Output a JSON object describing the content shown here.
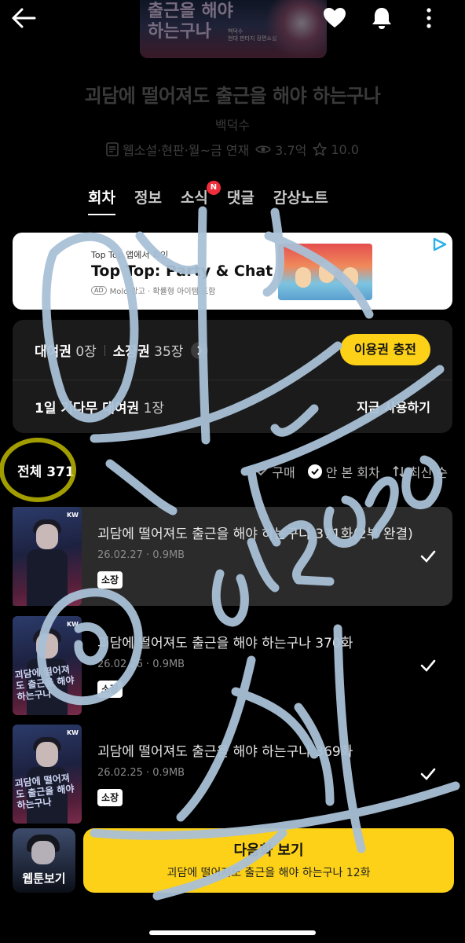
{
  "cover": {
    "title_art": "출근을 해야 하는구나",
    "author_line": "백덕수",
    "subtitle_line": "현대 판타지 장편소설"
  },
  "header": {
    "back_icon": "arrow-left-icon",
    "like_icon": "heart-icon",
    "notify_icon": "bell-icon",
    "more_icon": "more-vertical-icon"
  },
  "work": {
    "title": "괴담에 떨어져도 출근을 해야 하는구나",
    "author": "백덕수",
    "info": "웹소설·현판·월~금 연재",
    "views": "3.7억",
    "rating": "10.0"
  },
  "tabs": [
    {
      "label": "회차",
      "active": true
    },
    {
      "label": "정보",
      "active": false
    },
    {
      "label": "소식",
      "active": false,
      "badge": "N"
    },
    {
      "label": "댓글",
      "active": false
    },
    {
      "label": "감상노트",
      "active": false
    }
  ],
  "ad": {
    "line1": "Top Top 앱에서 확인",
    "title": "Top Top: Party & Chat",
    "badge": "AD",
    "line3": "Molo 광고 · 확률형 아이템 포함"
  },
  "passes": {
    "rental_label": "대여권",
    "rental_count": "0장",
    "own_label": "소장권",
    "own_count": "35장",
    "charge_label": "이용권 충전",
    "wait_label": "1일 기다무 대여권",
    "wait_count": "1장",
    "use_now": "지금 사용하기"
  },
  "list": {
    "total_label": "전체 371",
    "filter_buy": "구매",
    "filter_unread": "안 본 회차",
    "sort_label": "최신 순"
  },
  "episodes": [
    {
      "name": "괴담에 떨어져도 출근을 해야 하는구나 371화(2부 완결)",
      "date": "26.02.27 · 0.9MB",
      "tag": "소장",
      "thumb_title": "",
      "highlight": true
    },
    {
      "name": "괴담에 떨어져도 출근을 해야 하는구나 370화",
      "date": "26.02.26 · 0.9MB",
      "tag": "소장",
      "thumb_title": "괴담에 떨어져도 출근을 해야 하는구나",
      "highlight": false
    },
    {
      "name": "괴담에 떨어져도 출근을 해야 하는구나 369화",
      "date": "26.02.25 · 0.9MB",
      "tag": "소장",
      "thumb_title": "괴담에 떨어져도 출근을 해야 하는구나",
      "highlight": false
    }
  ],
  "bottom": {
    "webtoon_label": "웹툰보기",
    "next_title": "다음화 보기",
    "next_subtitle": "괴담에 떨어져도 출근을 해야 하는구나 12화"
  },
  "colors": {
    "accent_yellow": "#fcd117",
    "badge_red": "#f02d3a",
    "scribble_blue": "#a9c0d6",
    "scribble_yellow": "#c9c400"
  }
}
